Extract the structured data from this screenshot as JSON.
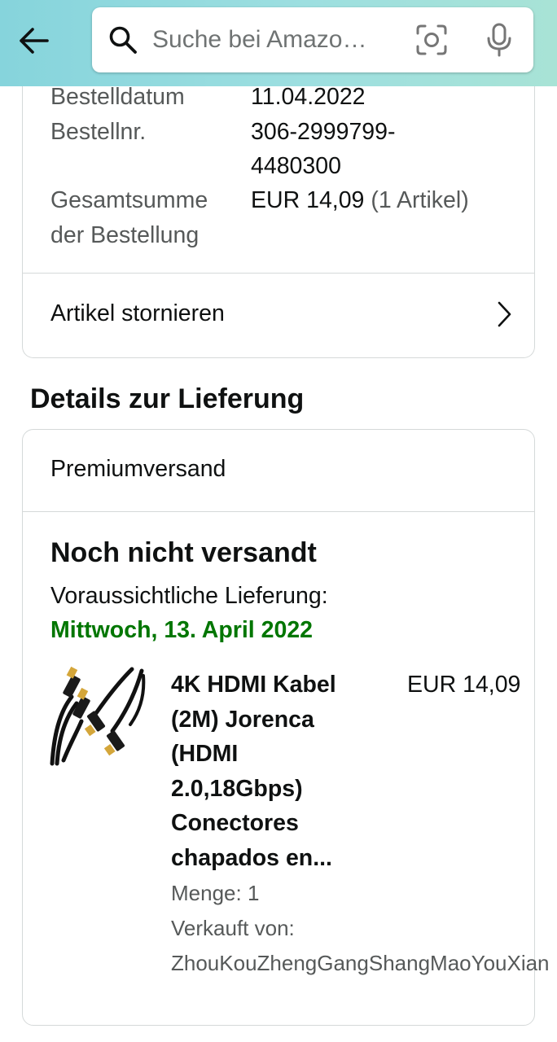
{
  "search": {
    "placeholder": "Suche bei Amazo…"
  },
  "order_summary": {
    "order_date_label": "Bestelldatum",
    "order_date": "11.04.2022",
    "order_number_label": "Bestellnr.",
    "order_number_line1": "306-2999799-",
    "order_number_line2": "4480300",
    "total_label_line1": "Gesamtsumme",
    "total_label_line2": "der Bestellung",
    "total_value": "EUR 14,09",
    "total_items": "(1 Artikel)",
    "cancel_label": "Artikel stornieren"
  },
  "delivery": {
    "section_title": "Details zur Lieferung",
    "shipping_method": "Premiumversand",
    "status": "Noch nicht versandt",
    "eta_label": "Voraussichtliche Lieferung:",
    "eta_date": "Mittwoch, 13. April 2022",
    "eta_color": "#007600"
  },
  "item": {
    "title_lines": [
      "4K HDMI Kabel",
      "(2M) Jorenca",
      "(HDMI",
      "2.0,18Gbps)",
      "Conectores",
      "chapados en..."
    ],
    "price": "EUR 14,09",
    "quantity": "Menge: 1",
    "sold_by_label": "Verkauft von:",
    "seller": "ZhouKouZhengGangShangMaoYouXian"
  },
  "colors": {
    "header_gradient_start": "#86d4dc",
    "header_gradient_end": "#a8e3d6",
    "border": "#d5d9d9",
    "muted_text": "#565959"
  },
  "icons": [
    "back-arrow-icon",
    "search-icon",
    "camera-icon",
    "microphone-icon",
    "chevron-right-icon",
    "hdmi-cable-product-image"
  ]
}
